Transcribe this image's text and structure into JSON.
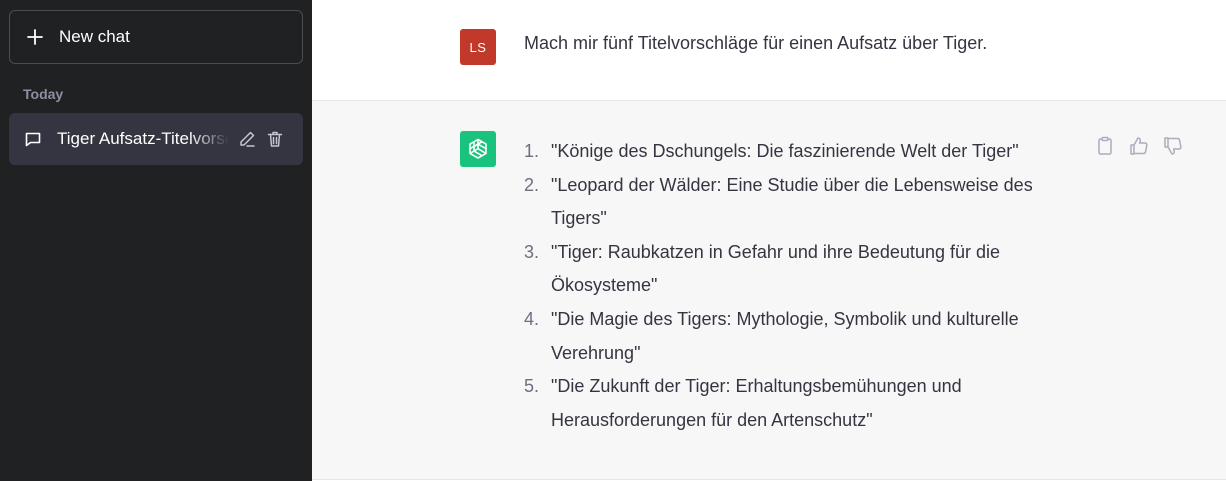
{
  "sidebar": {
    "new_chat_label": "New chat",
    "section_today": "Today",
    "chats": [
      {
        "title": "Tiger Aufsatz-Titelvorschläge"
      }
    ]
  },
  "conversation": {
    "user_avatar_initials": "LS",
    "user_message": "Mach mir fünf Titelvorschläge für einen Aufsatz über Tiger.",
    "assistant_items": [
      {
        "num": "1.",
        "text": "\"Könige des Dschungels: Die faszinierende Welt der Tiger\""
      },
      {
        "num": "2.",
        "text": "\"Leopard der Wälder: Eine Studie über die Lebensweise des Tigers\""
      },
      {
        "num": "3.",
        "text": "\"Tiger: Raubkatzen in Gefahr und ihre Bedeutung für die Ökosysteme\""
      },
      {
        "num": "4.",
        "text": "\"Die Magie des Tigers: Mythologie, Symbolik und kulturelle Verehrung\""
      },
      {
        "num": "5.",
        "text": "\"Die Zukunft der Tiger: Erhaltungsbemühungen und Herausforderungen für den Artenschutz\""
      }
    ]
  },
  "colors": {
    "sidebar_bg": "#202123",
    "active_item_bg": "#343541",
    "user_avatar": "#c0392b",
    "assistant_avatar": "#19c37d",
    "assistant_row_bg": "#f7f7f8"
  }
}
